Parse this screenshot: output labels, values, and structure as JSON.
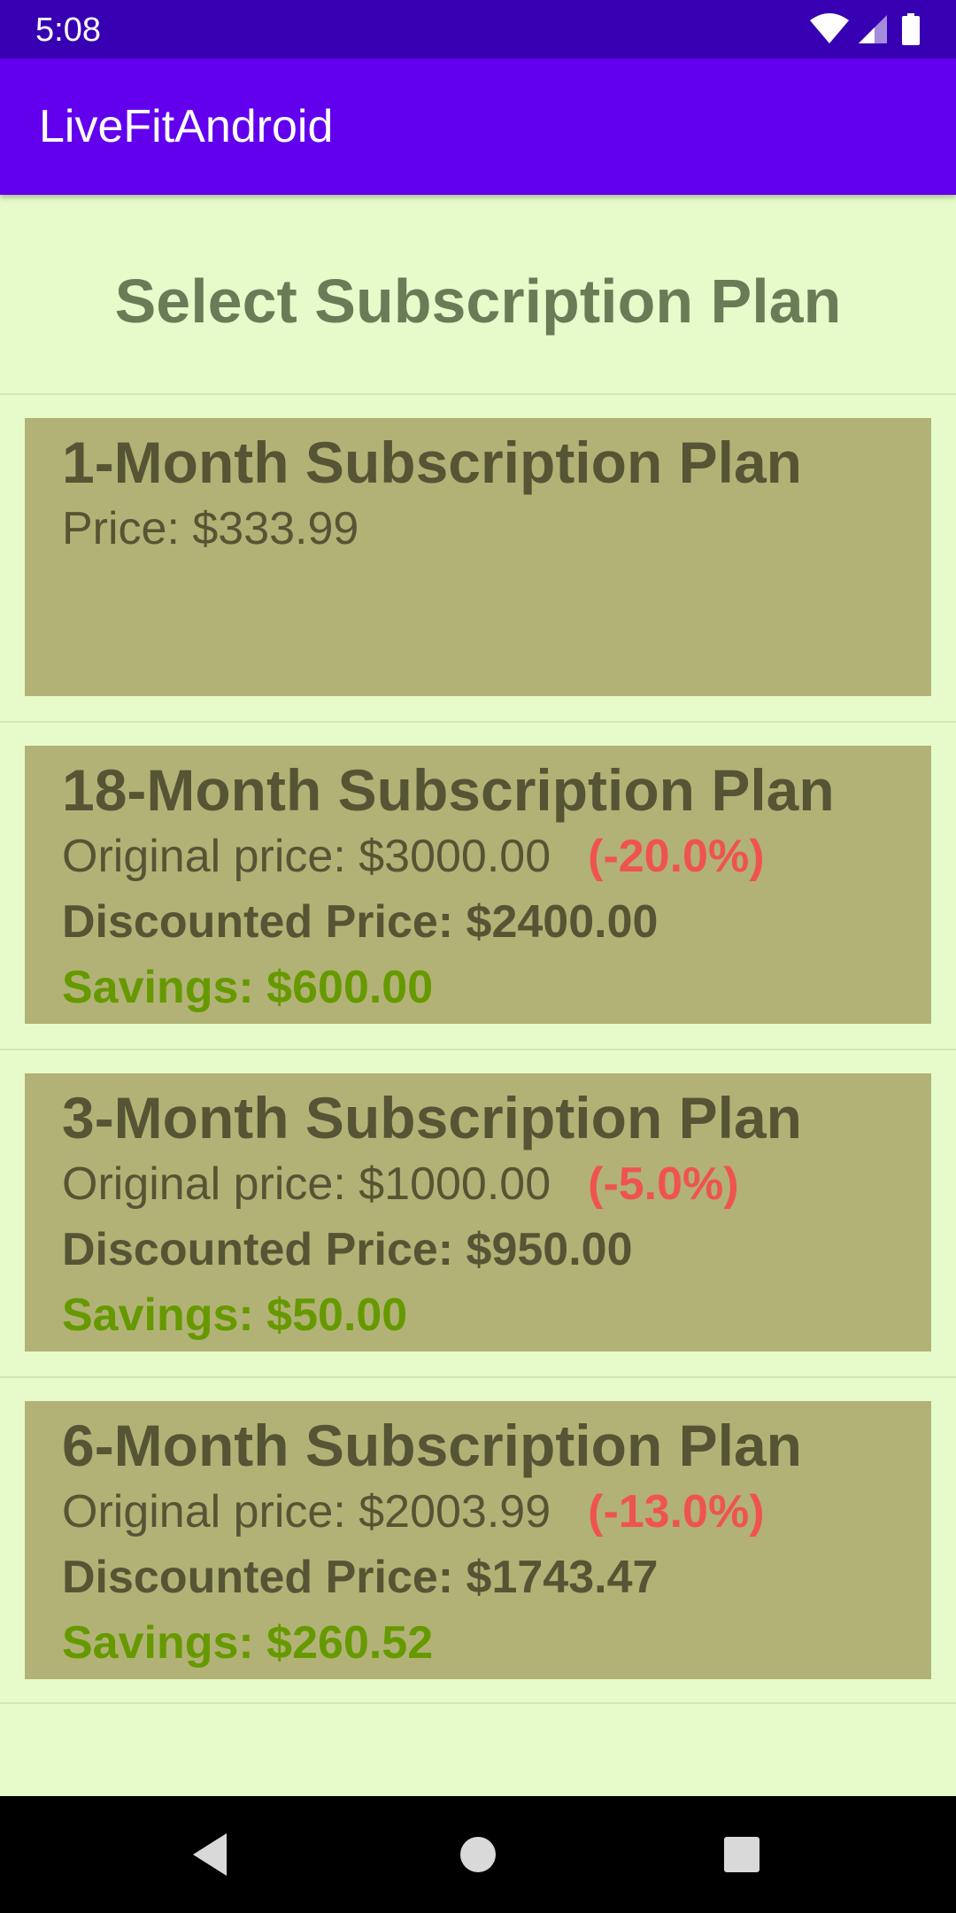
{
  "status_bar": {
    "time": "5:08",
    "icons": [
      "wifi-icon",
      "cellular-signal-icon",
      "battery-icon"
    ]
  },
  "app_bar": {
    "title": "LiveFitAndroid"
  },
  "heading": "Select Subscription Plan",
  "plans": [
    {
      "title": "1-Month Subscription Plan",
      "price_text": "Price: $333.99"
    },
    {
      "title": "18-Month Subscription Plan",
      "original_price": "Original price: $3000.00",
      "discount_pct": "(-20.0%)",
      "discounted_price": "Discounted Price: $2400.00",
      "savings": "Savings: $600.00"
    },
    {
      "title": "3-Month Subscription Plan",
      "original_price": "Original price: $1000.00",
      "discount_pct": "(-5.0%)",
      "discounted_price": "Discounted Price: $950.00",
      "savings": "Savings: $50.00"
    },
    {
      "title": "6-Month Subscription Plan",
      "original_price": "Original price: $2003.99",
      "discount_pct": "(-13.0%)",
      "discounted_price": "Discounted Price: $1743.47",
      "savings": "Savings: $260.52"
    }
  ],
  "nav_bar": {
    "buttons": [
      "back-icon",
      "home-icon",
      "recents-icon"
    ]
  },
  "colors": {
    "status_bar": "#3700b3",
    "app_bar": "#6200ee",
    "background": "#e6fbc9",
    "card": "#b2b276",
    "card_text": "#555535",
    "heading": "#6b7a57",
    "discount": "#ef5350",
    "savings": "#669900"
  }
}
